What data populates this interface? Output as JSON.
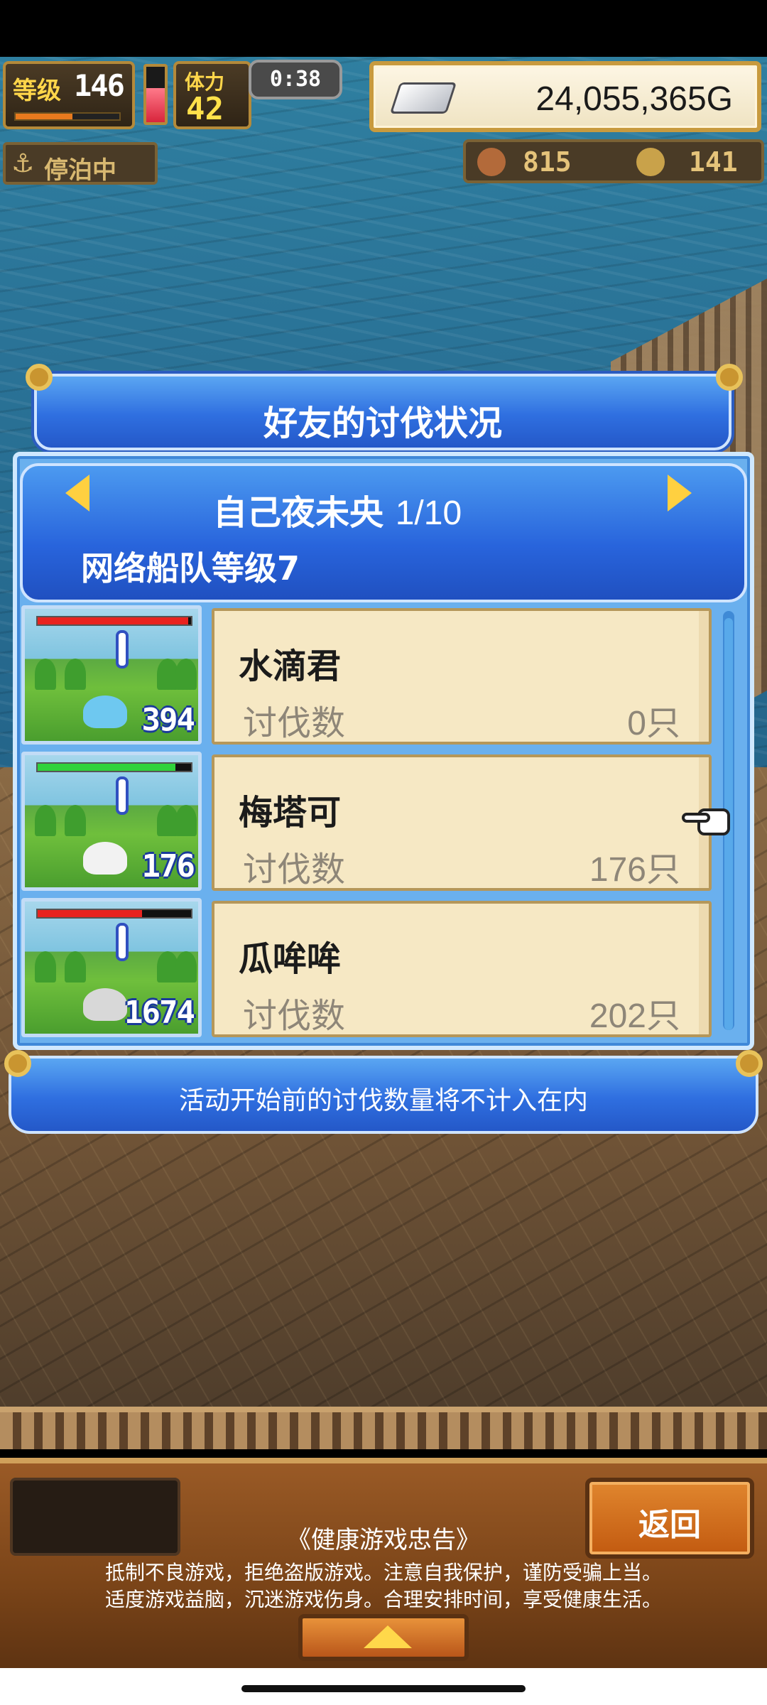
{
  "hud": {
    "level_label": "等级",
    "level_value": "146",
    "stamina_label": "体力",
    "stamina_value": "42",
    "timer": "0:38",
    "gold": "24,055,365G",
    "anchored_label": "停泊中",
    "resource_a": "815",
    "resource_b": "141"
  },
  "dialog": {
    "title": "好友的讨伐状况",
    "friend_name": "自己夜未央",
    "page_indicator": "1/10",
    "fleet_level": "网络船队等级7",
    "kill_label": "讨伐数",
    "unit": "只",
    "footer_note": "活动开始前的讨伐数量将不计入在内",
    "monsters": [
      {
        "name": "水滴君",
        "count": "394",
        "kills": "0",
        "hp_fill": 0.98,
        "hp_color": "#e8231f",
        "critter_color": "#6ec8f0"
      },
      {
        "name": "梅塔可",
        "count": "176",
        "kills": "176",
        "hp_fill": 0.9,
        "hp_color": "#2fd23a",
        "critter_color": "#f2f2f2"
      },
      {
        "name": "瓜哞哞",
        "count": "1674",
        "kills": "202",
        "hp_fill": 0.68,
        "hp_color": "#e8231f",
        "critter_color": "#d8d8d8"
      }
    ]
  },
  "bottom": {
    "back_label": "返回",
    "notice_title": "《健康游戏忠告》",
    "notice_line1": "抵制不良游戏，拒绝盗版游戏。注意自我保护，谨防受骗上当。",
    "notice_line2": "适度游戏益脑，沉迷游戏伤身。合理安排时间，享受健康生活。"
  },
  "colors": {
    "dialog_blue": "#2f6fe0",
    "card_bg": "#f6e8c4",
    "gold_frame": "#c89a3e"
  },
  "progress": {
    "level_xp": 0.55,
    "stamina": 0.62
  }
}
